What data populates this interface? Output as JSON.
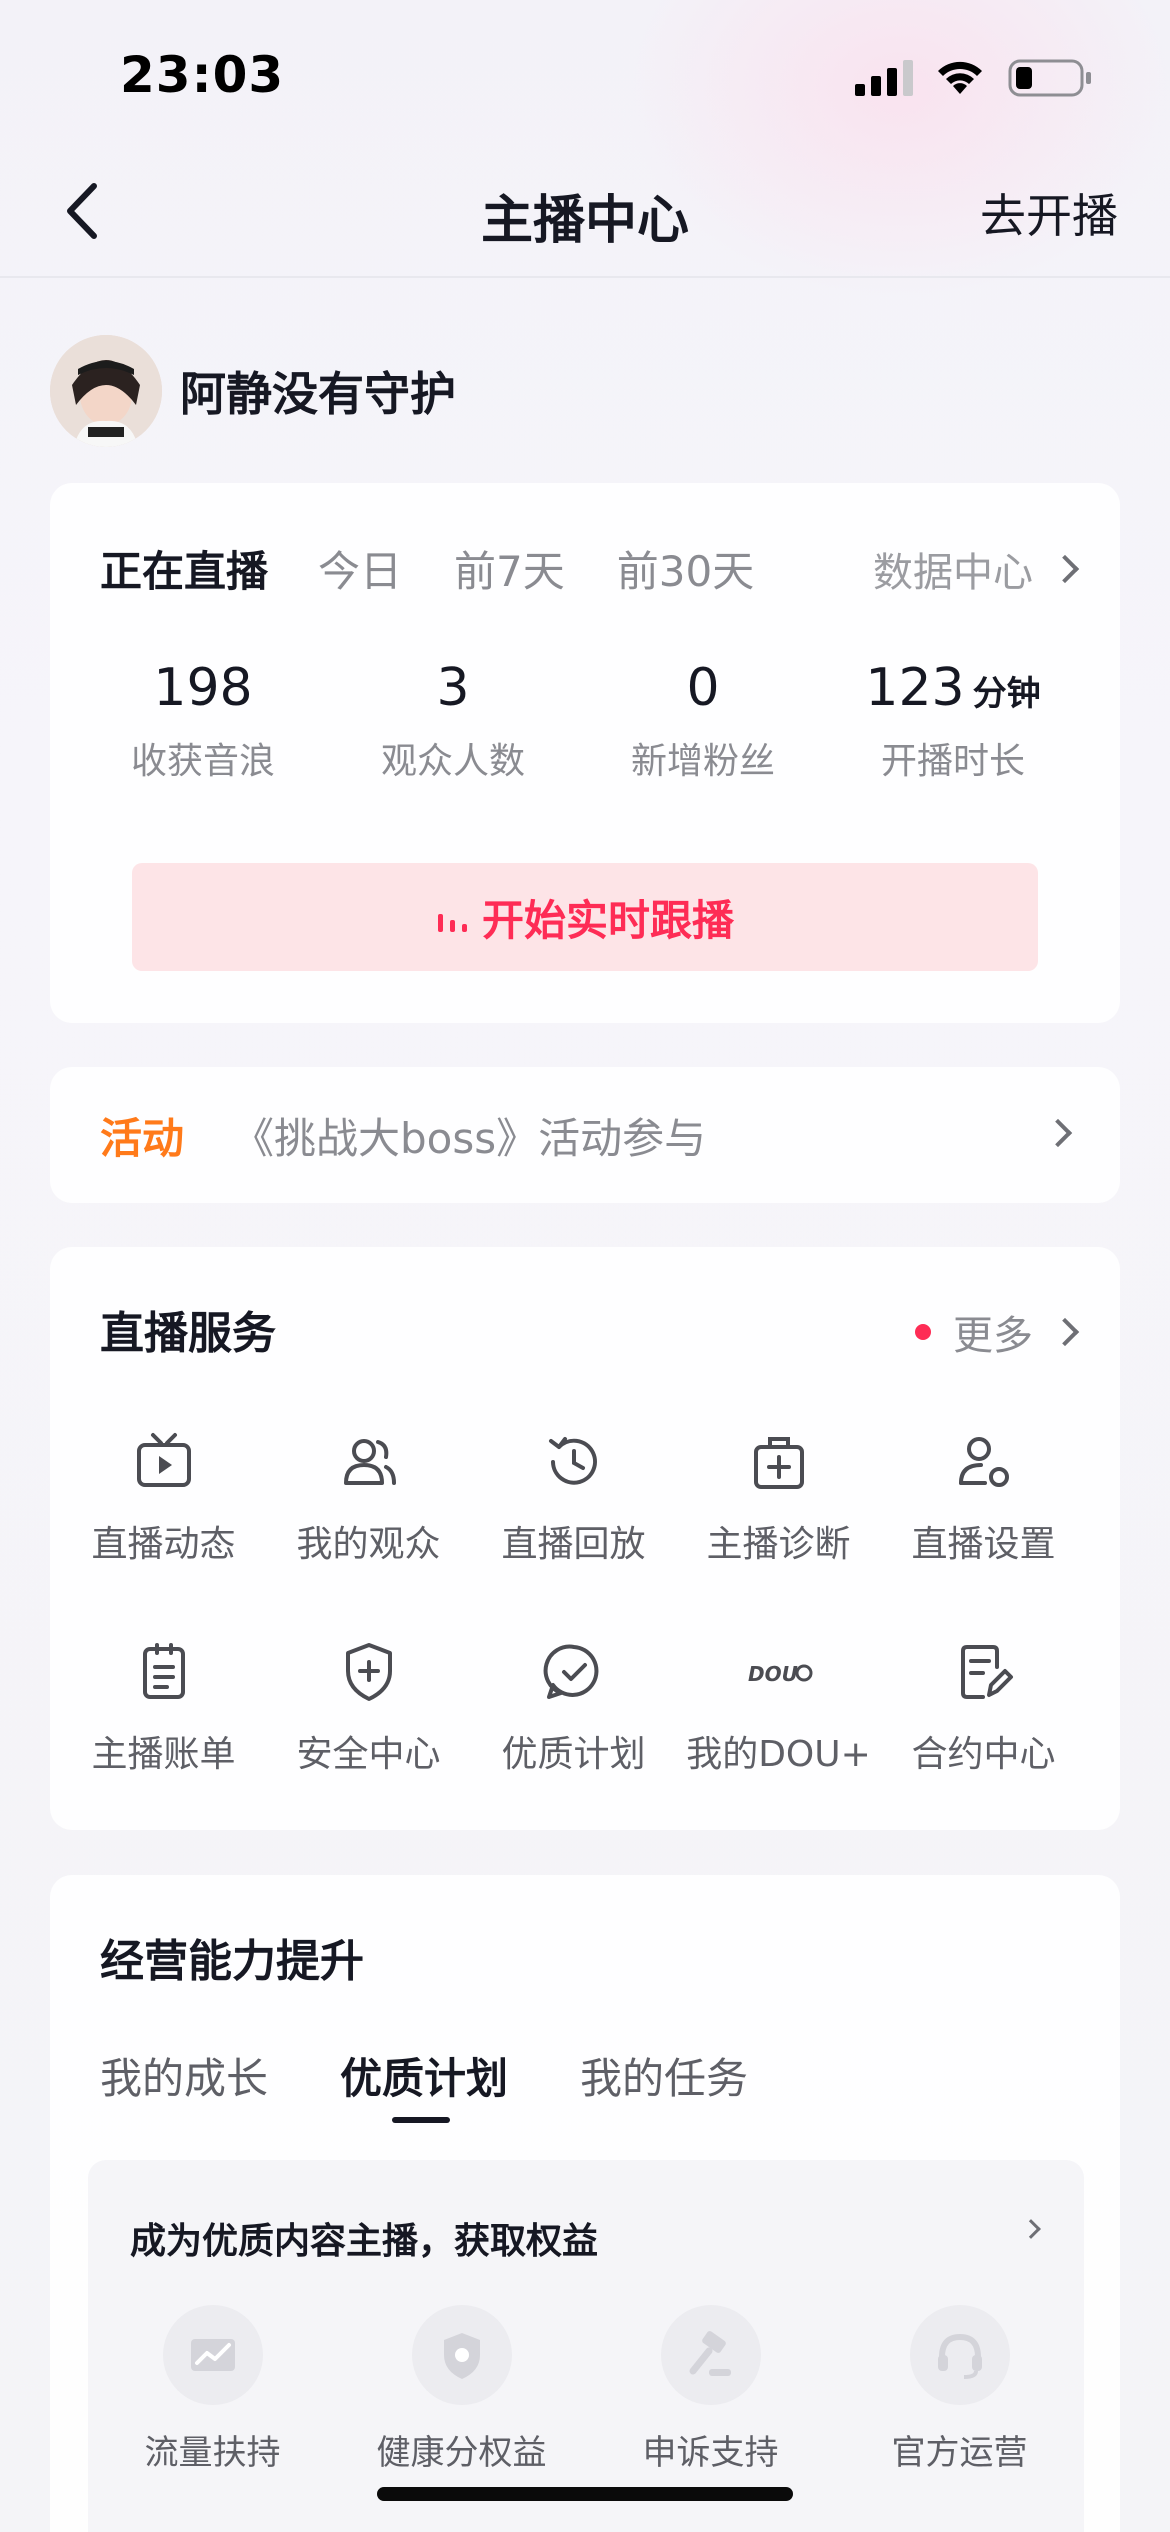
{
  "status_bar": {
    "time": "23:03"
  },
  "nav": {
    "title": "主播中心",
    "go_live": "去开播"
  },
  "profile": {
    "name": "阿静没有守护"
  },
  "live_data": {
    "tabs": [
      "正在直播",
      "今日",
      "前7天",
      "前30天"
    ],
    "data_center": "数据中心",
    "stats": [
      {
        "value": "198",
        "unit": "",
        "label": "收获音浪"
      },
      {
        "value": "3",
        "unit": "",
        "label": "观众人数"
      },
      {
        "value": "0",
        "unit": "",
        "label": "新增粉丝"
      },
      {
        "value": "123",
        "unit": "分钟",
        "label": "开播时长"
      }
    ],
    "follow_button": "开始实时跟播"
  },
  "activity": {
    "tag": "活动",
    "text": "《挑战大boss》活动参与"
  },
  "services": {
    "title": "直播服务",
    "more": "更多",
    "items": [
      {
        "label": "直播动态",
        "icon": "tv-play-icon"
      },
      {
        "label": "我的观众",
        "icon": "users-icon"
      },
      {
        "label": "直播回放",
        "icon": "history-icon"
      },
      {
        "label": "主播诊断",
        "icon": "medical-kit-icon"
      },
      {
        "label": "直播设置",
        "icon": "user-settings-icon"
      },
      {
        "label": "主播账单",
        "icon": "bill-icon"
      },
      {
        "label": "安全中心",
        "icon": "shield-plus-icon"
      },
      {
        "label": "优质计划",
        "icon": "chat-check-icon"
      },
      {
        "label": "我的DOU+",
        "icon": "dou-plus-icon"
      },
      {
        "label": "合约中心",
        "icon": "contract-edit-icon"
      }
    ],
    "dou_text": "DOU"
  },
  "growth": {
    "title": "经营能力提升",
    "tabs": [
      "我的成长",
      "优质计划",
      "我的任务"
    ],
    "active_tab": 1,
    "benefit_title": "成为优质内容主播，获取权益",
    "benefits": [
      {
        "label": "流量扶持",
        "icon": "traffic-chart-icon"
      },
      {
        "label": "健康分权益",
        "icon": "shield-icon"
      },
      {
        "label": "申诉支持",
        "icon": "gavel-icon"
      },
      {
        "label": "官方运营",
        "icon": "headset-icon"
      }
    ]
  },
  "colors": {
    "accent": "#fe2c55",
    "activity": "#ff7a1a",
    "follow_bg": "#fde4e7"
  }
}
